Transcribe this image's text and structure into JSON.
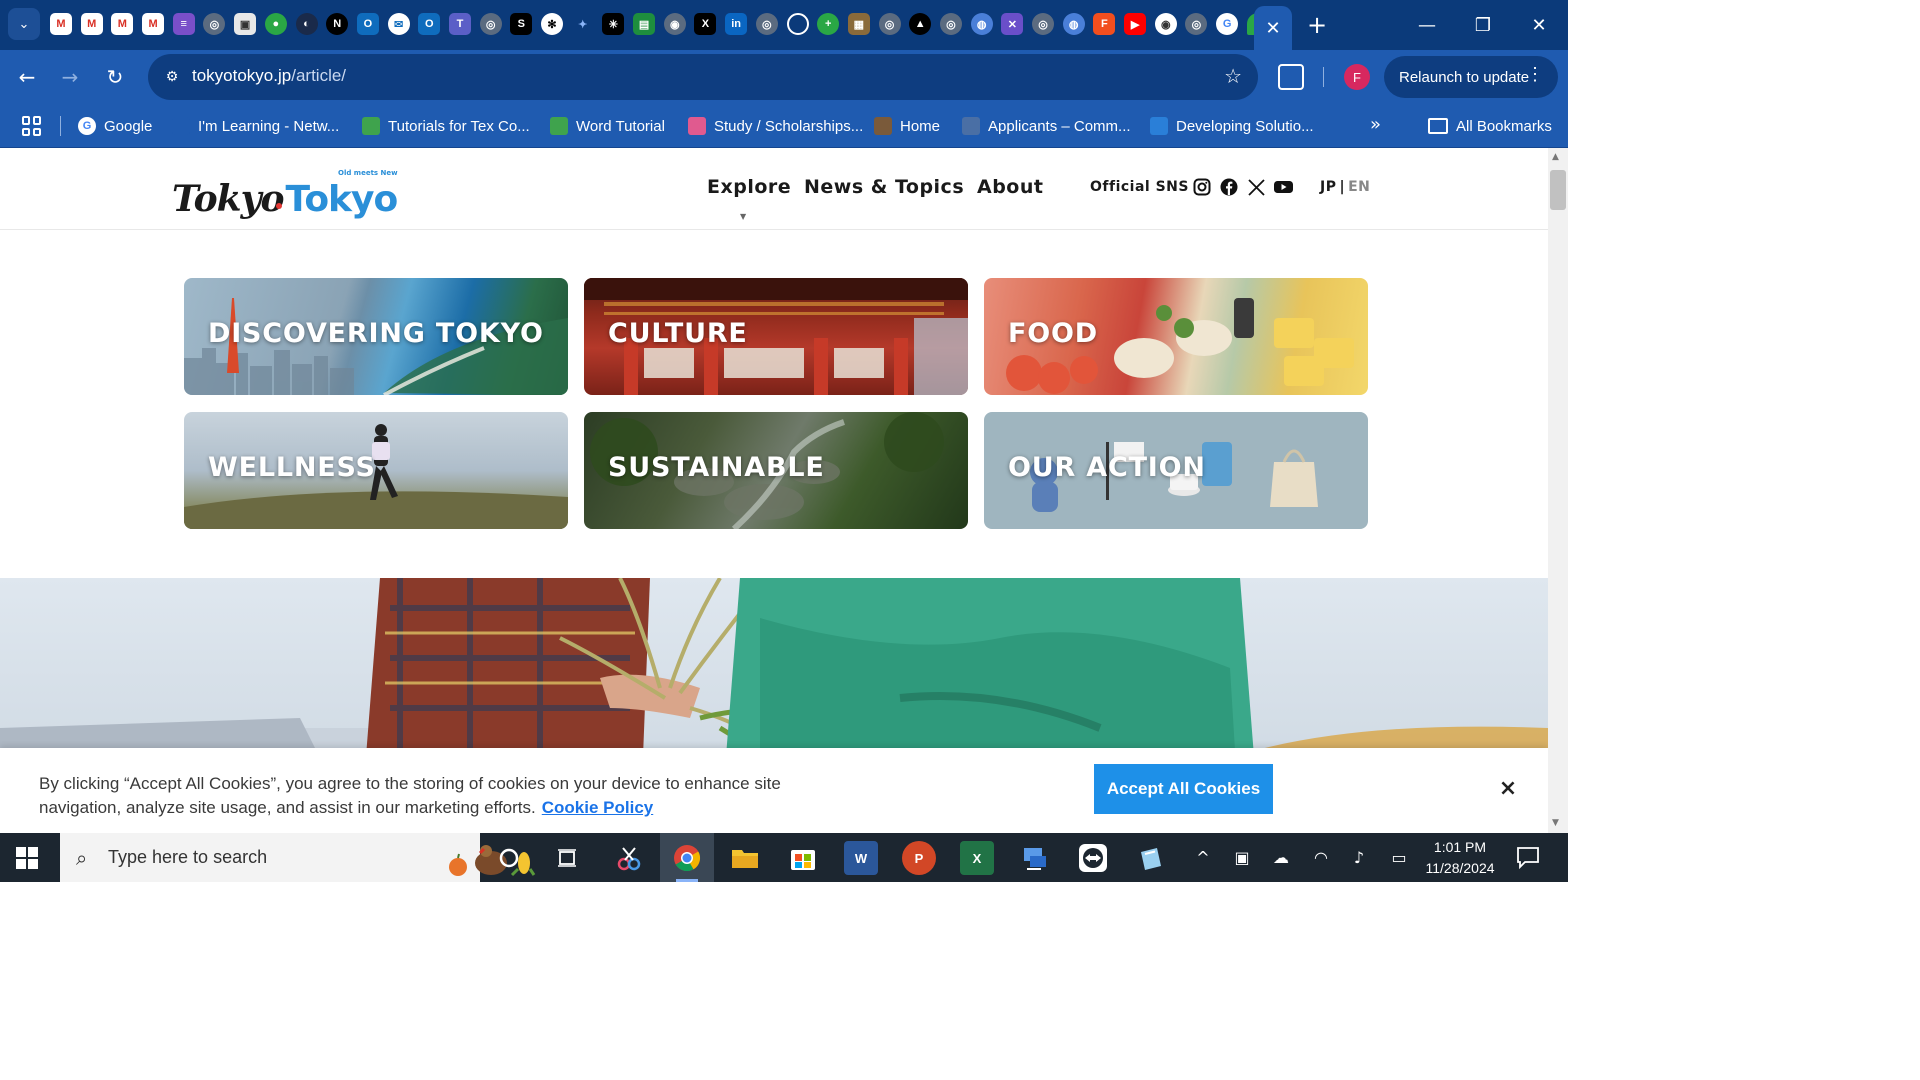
{
  "browser": {
    "active_tab_close": "✕",
    "new_tab": "+",
    "url_host": "tokyotokyo.jp",
    "url_path": "/article/",
    "profile_initial": "F",
    "relaunch_label": "Relaunch to update",
    "bookmarks": [
      {
        "label": "Google",
        "icon": "google-icon",
        "color": "#ffffff"
      },
      {
        "label": "I'm Learning - Netw...",
        "icon": "cisco-icon",
        "color": "#1f5bb0"
      },
      {
        "label": "Tutorials for Tex Co...",
        "icon": "tutorials-icon",
        "color": "#3fa34d"
      },
      {
        "label": "Word Tutorial",
        "icon": "word-tutorial-icon",
        "color": "#3fa34d"
      },
      {
        "label": "Study / Scholarships...",
        "icon": "study-icon",
        "color": "#e05a8f"
      },
      {
        "label": "Home",
        "icon": "home-icon",
        "color": "#7a5a3a"
      },
      {
        "label": "Applicants – Comm...",
        "icon": "applicants-icon",
        "color": "#4a6fa5"
      },
      {
        "label": "Developing Solutio...",
        "icon": "developing-icon",
        "color": "#2a7fd8"
      }
    ],
    "bookmarks_more": "»",
    "all_bookmarks": "All Bookmarks"
  },
  "site": {
    "logo_part1": "Tokyo",
    "logo_part2": "Tokyo",
    "logo_tagline": "Old meets New",
    "nav": [
      "Explore",
      "News & Topics",
      "About"
    ],
    "sns_label": "Official SNS",
    "sns_icons": [
      "instagram-icon",
      "facebook-icon",
      "x-icon",
      "youtube-icon"
    ],
    "lang_jp": "JP",
    "lang_sep": "|",
    "lang_en": "EN",
    "categories": [
      {
        "label": "DISCOVERING TOKYO"
      },
      {
        "label": "CULTURE"
      },
      {
        "label": "FOOD"
      },
      {
        "label": "WELLNESS"
      },
      {
        "label": "SUSTAINABLE"
      },
      {
        "label": "OUR ACTION"
      }
    ]
  },
  "cookie": {
    "text": "By clicking “Accept All Cookies”, you agree to the storing of cookies on your device to enhance site navigation, analyze site usage, and assist in our marketing efforts.",
    "link": "Cookie Policy",
    "accept": "Accept All Cookies",
    "close": "×"
  },
  "taskbar": {
    "search_placeholder": "Type here to search",
    "time": "1:01 PM",
    "date": "11/28/2024"
  },
  "colors": {
    "chrome_dark": "#0b3a7a",
    "chrome_toolbar": "#1f5bb0",
    "accent_blue": "#1e90e8",
    "logo_blue": "#2a8fd8"
  }
}
